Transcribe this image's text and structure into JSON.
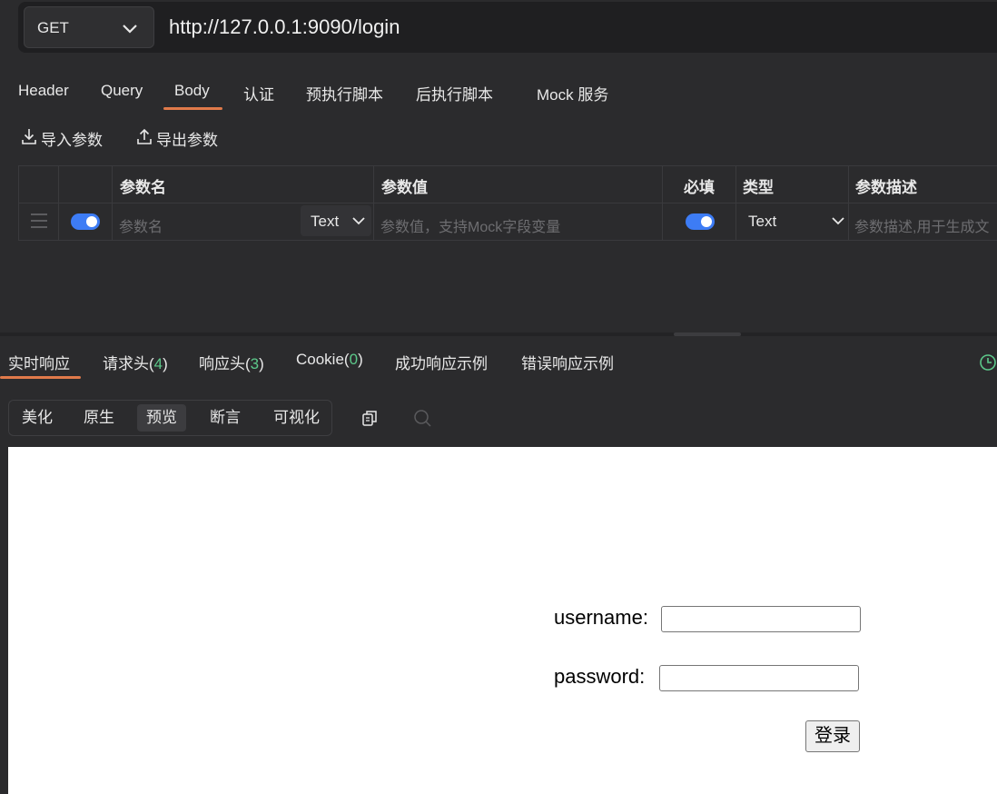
{
  "request": {
    "method": "GET",
    "url": "http://127.0.0.1:9090/login"
  },
  "request_tabs": [
    "Header",
    "Query",
    "Body",
    "认证",
    "预执行脚本",
    "后执行脚本",
    "Mock 服务"
  ],
  "active_request_tab": "Body",
  "body_actions": {
    "import": "导入参数",
    "export": "导出参数"
  },
  "params_table": {
    "headers": {
      "name": "参数名",
      "value": "参数值",
      "required": "必填",
      "type": "类型",
      "description": "参数描述"
    },
    "row": {
      "name_placeholder": "参数名",
      "name_type": "Text",
      "value_placeholder": "参数值，支持Mock字段变量",
      "enabled": true,
      "required": true,
      "type": "Text",
      "description_placeholder": "参数描述,用于生成文"
    }
  },
  "response_tabs": {
    "realtime": "实时响应",
    "req_headers_label": "请求头(",
    "req_headers_count": "4",
    "resp_headers_label": "响应头(",
    "resp_headers_count": "3",
    "cookie_label": "Cookie(",
    "cookie_count": "0",
    "close_paren": ")",
    "success_example": "成功响应示例",
    "error_example": "错误响应示例"
  },
  "view_modes": [
    "美化",
    "原生",
    "预览",
    "断言",
    "可视化"
  ],
  "active_view_mode": "预览",
  "preview": {
    "username_label": "username:",
    "password_label": "password:",
    "login_button": "登录"
  },
  "colors": {
    "accent": "#e07a4a",
    "toggle": "#3d7cf5",
    "count": "#5cc98a"
  }
}
